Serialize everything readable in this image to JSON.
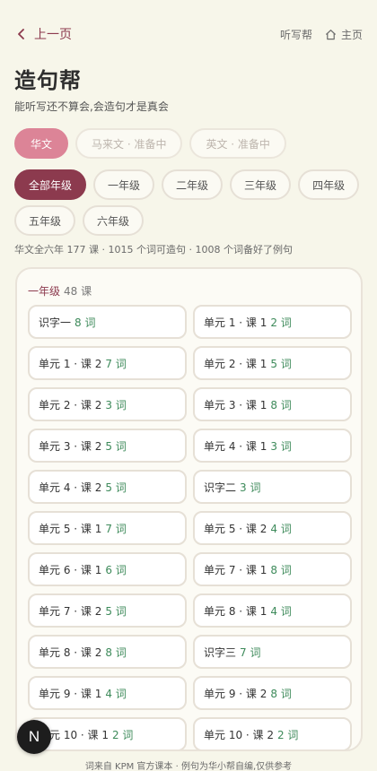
{
  "nav": {
    "back_label": "上一页",
    "dictation_label": "听写帮",
    "home_label": "主页"
  },
  "header": {
    "title": "造句帮",
    "subtitle": "能听写还不算会,会造句才是真会"
  },
  "languages": [
    {
      "label": "华文",
      "active": true
    },
    {
      "label": "马来文 · 准备中",
      "active": false
    },
    {
      "label": "英文 · 准备中",
      "active": false
    }
  ],
  "grades_row1": [
    {
      "label": "全部年级",
      "active": true
    },
    {
      "label": "一年级",
      "active": false
    },
    {
      "label": "二年级",
      "active": false
    },
    {
      "label": "三年级",
      "active": false
    },
    {
      "label": "四年级",
      "active": false
    }
  ],
  "grades_row2": [
    {
      "label": "五年级",
      "active": false
    },
    {
      "label": "六年级",
      "active": false
    }
  ],
  "stats": "华文全六年 177 课 · 1015 个词可造句 · 1008 个词备好了例句",
  "grade_card": {
    "grade": "一年级",
    "count": "48 课",
    "lessons": [
      {
        "name": "识字一",
        "words": "8 词"
      },
      {
        "name": "单元 1 · 课 1",
        "words": "2 词"
      },
      {
        "name": "单元 1 · 课 2",
        "words": "7 词"
      },
      {
        "name": "单元 2 · 课 1",
        "words": "5 词"
      },
      {
        "name": "单元 2 · 课 2",
        "words": "3 词"
      },
      {
        "name": "单元 3 · 课 1",
        "words": "8 词"
      },
      {
        "name": "单元 3 · 课 2",
        "words": "5 词"
      },
      {
        "name": "单元 4 · 课 1",
        "words": "3 词"
      },
      {
        "name": "单元 4 · 课 2",
        "words": "5 词"
      },
      {
        "name": "识字二",
        "words": "3 词"
      },
      {
        "name": "单元 5 · 课 1",
        "words": "7 词"
      },
      {
        "name": "单元 5 · 课 2",
        "words": "4 词"
      },
      {
        "name": "单元 6 · 课 1",
        "words": "6 词"
      },
      {
        "name": "单元 7 · 课 1",
        "words": "8 词"
      },
      {
        "name": "单元 7 · 课 2",
        "words": "5 词"
      },
      {
        "name": "单元 8 · 课 1",
        "words": "4 词"
      },
      {
        "name": "单元 8 · 课 2",
        "words": "8 词"
      },
      {
        "name": "识字三",
        "words": "7 词"
      },
      {
        "name": "单元 9 · 课 1",
        "words": "4 词"
      },
      {
        "name": "单元 9 · 课 2",
        "words": "8 词"
      },
      {
        "name": "单元 10 · 课 1",
        "words": "2 词"
      },
      {
        "name": "单元 10 · 课 2",
        "words": "2 词"
      }
    ]
  },
  "footer": "词来自 KPM 官方课本 · 例句为华小帮自编,仅供参考",
  "fab_label": "N",
  "colors": {
    "background": "#f7f6ea",
    "accent": "#8c3a4e",
    "pink": "#dc8497",
    "word_count": "#3d8a5a"
  }
}
